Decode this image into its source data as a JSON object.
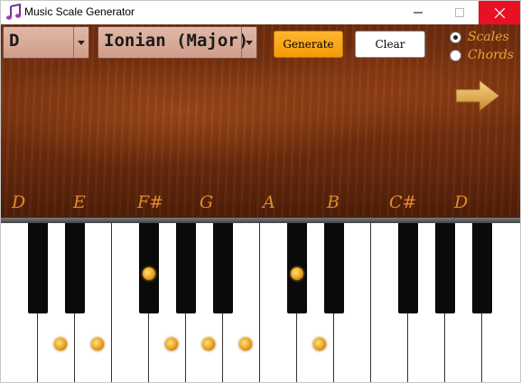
{
  "window": {
    "title": "Music Scale Generator"
  },
  "controls": {
    "key_select": {
      "value": "D"
    },
    "mode_select": {
      "value": "Ionian (Major)"
    },
    "generate_label": "Generate",
    "clear_label": "Clear",
    "radio_options": [
      {
        "label": "Scales",
        "checked": true
      },
      {
        "label": "Chords",
        "checked": false
      }
    ]
  },
  "scale_notes": [
    "D",
    "E",
    "F#",
    "G",
    "A",
    "B",
    "C#",
    "D"
  ],
  "colors": {
    "accent_orange": "#f59a07",
    "note_label": "#e5892e",
    "close_red": "#e81123"
  },
  "icons": {
    "app": "music-note-icon",
    "next": "right-arrow-icon"
  }
}
